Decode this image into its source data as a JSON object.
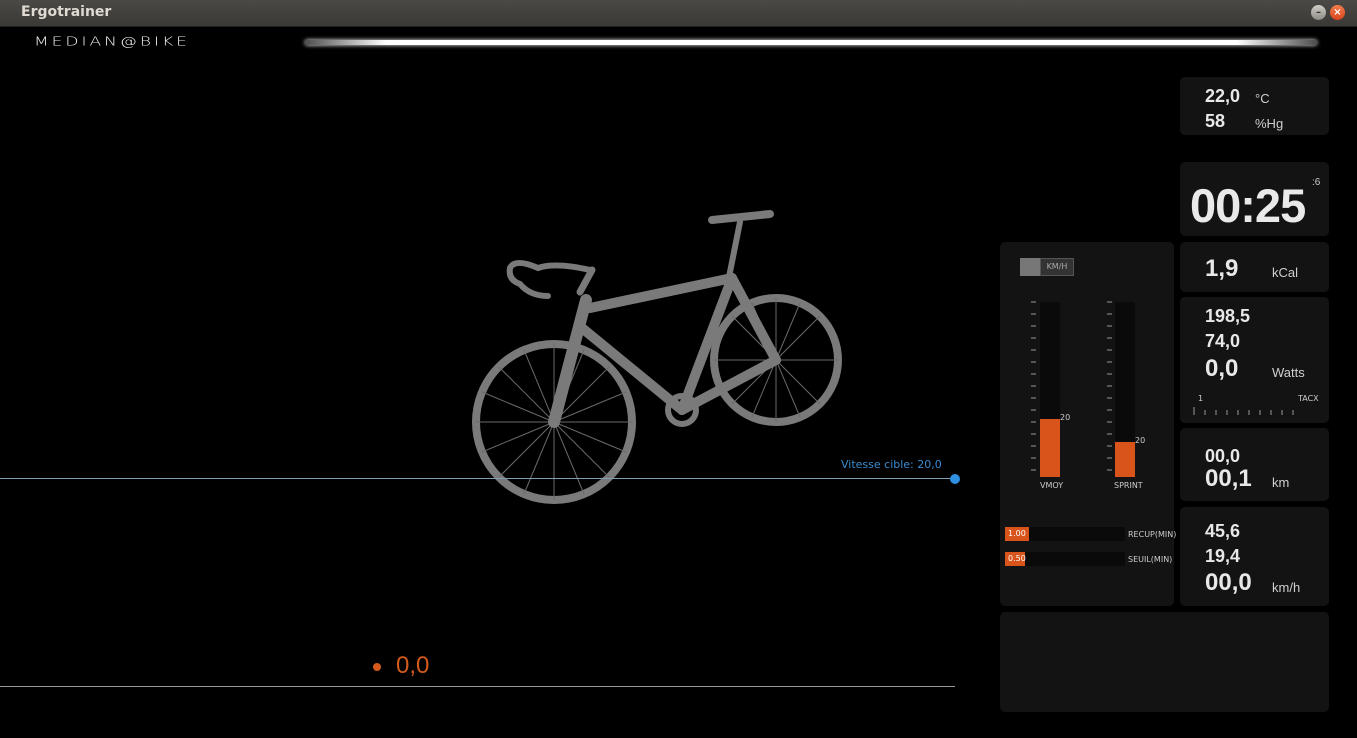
{
  "window": {
    "title": "Ergotrainer"
  },
  "brand": {
    "logo": "MEDIAN@BIKE"
  },
  "track": {
    "target_label": "Vitesse cible: 20,0",
    "current_speed": "0,0"
  },
  "env": {
    "temperature": "22,0",
    "temperature_unit": "°C",
    "humidity": "58",
    "humidity_unit": "%Hg"
  },
  "timer": {
    "time": "00:25",
    "seconds": ":6"
  },
  "calories": {
    "value": "1,9",
    "unit": "kCal"
  },
  "power": {
    "max": "198,5",
    "avg": "74,0",
    "current": "0,0",
    "unit": "Watts",
    "scale_start": "1",
    "scale_label": "TACX"
  },
  "distance": {
    "top": "00,0",
    "value": "00,1",
    "unit": "km"
  },
  "speed": {
    "max": "45,6",
    "avg": "19,4",
    "current": "00,0",
    "unit": "km/h"
  },
  "bars": {
    "unit_toggle": "KM/H",
    "vmoy": {
      "label": "VMOY",
      "value": "20",
      "fill": 0.33
    },
    "sprint": {
      "label": "SPRINT",
      "value": "20",
      "fill": 0.2
    }
  },
  "hbars": {
    "recup": {
      "label": "RECUP(MIN)",
      "value": "1.00",
      "fill": 0.2
    },
    "seuil": {
      "label": "SEUIL(MIN)",
      "value": "0.50",
      "fill": 0.17
    }
  },
  "colors": {
    "accent": "#d9541a",
    "target": "#2f8fe0"
  }
}
